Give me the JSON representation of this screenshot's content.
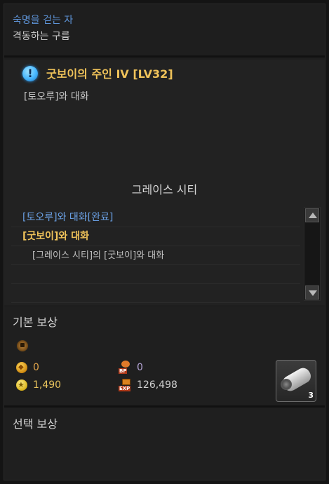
{
  "header": {
    "episode": "숙명을 걷는 자",
    "chapter": "격동하는 구름"
  },
  "quest": {
    "icon": "exclamation-icon",
    "icon_glyph": "!",
    "title": "굿보이의 주인 IV [LV32]",
    "description": "[토오루]와 대화",
    "region": "그레이스 시티",
    "objectives": [
      {
        "text": "[토오루]와 대화[완료]",
        "state": "done"
      },
      {
        "text": "[굿보이]와 대화",
        "state": "active"
      },
      {
        "text": "[그레이스 시티]의 [굿보이]와 대화",
        "state": "sub"
      }
    ]
  },
  "rewards": {
    "basic_title": "기본 보상",
    "choice_title": "선택 보상",
    "gold": "0",
    "bp": "0",
    "silver": "1,490",
    "exp": "126,498",
    "bp_label": "BP",
    "exp_label": "EXP",
    "item_quantity": "3"
  },
  "colors": {
    "episode": "#5e94d8",
    "quest_title": "#f0c35a",
    "objective_done": "#6aa0e4",
    "objective_active": "#f0c35a"
  }
}
